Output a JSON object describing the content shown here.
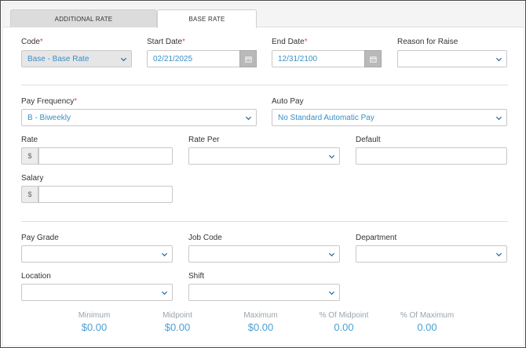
{
  "tabs": [
    {
      "label": "ADDITIONAL RATE"
    },
    {
      "label": "BASE RATE"
    }
  ],
  "fields": {
    "code": {
      "label": "Code",
      "value": "Base - Base Rate"
    },
    "start_date": {
      "label": "Start Date",
      "value": "02/21/2025"
    },
    "end_date": {
      "label": "End Date",
      "value": "12/31/2100"
    },
    "reason": {
      "label": "Reason for Raise",
      "value": ""
    },
    "pay_frequency": {
      "label": "Pay Frequency",
      "value": "B - Biweekly"
    },
    "auto_pay": {
      "label": "Auto Pay",
      "value": "No Standard Automatic Pay"
    },
    "rate": {
      "label": "Rate",
      "prefix": "$",
      "value": ""
    },
    "rate_per": {
      "label": "Rate Per",
      "value": ""
    },
    "default": {
      "label": "Default",
      "value": ""
    },
    "salary": {
      "label": "Salary",
      "prefix": "$",
      "value": ""
    },
    "pay_grade": {
      "label": "Pay Grade",
      "value": ""
    },
    "job_code": {
      "label": "Job Code",
      "value": ""
    },
    "department": {
      "label": "Department",
      "value": ""
    },
    "location": {
      "label": "Location",
      "value": ""
    },
    "shift": {
      "label": "Shift",
      "value": ""
    }
  },
  "required_mark": "*",
  "stats": [
    {
      "label": "Minimum",
      "value": "$0.00"
    },
    {
      "label": "Midpoint",
      "value": "$0.00"
    },
    {
      "label": "Maximum",
      "value": "$0.00"
    },
    {
      "label": "% Of Midpoint",
      "value": "0.00"
    },
    {
      "label": "% Of Maximum",
      "value": "0.00"
    }
  ],
  "icons": {
    "select": "chevron-down-icon",
    "date": "calendar-icon"
  },
  "colors": {
    "value_text": "#3a8fc7",
    "required": "#d9534f",
    "stat_value": "#4aa0d4"
  }
}
